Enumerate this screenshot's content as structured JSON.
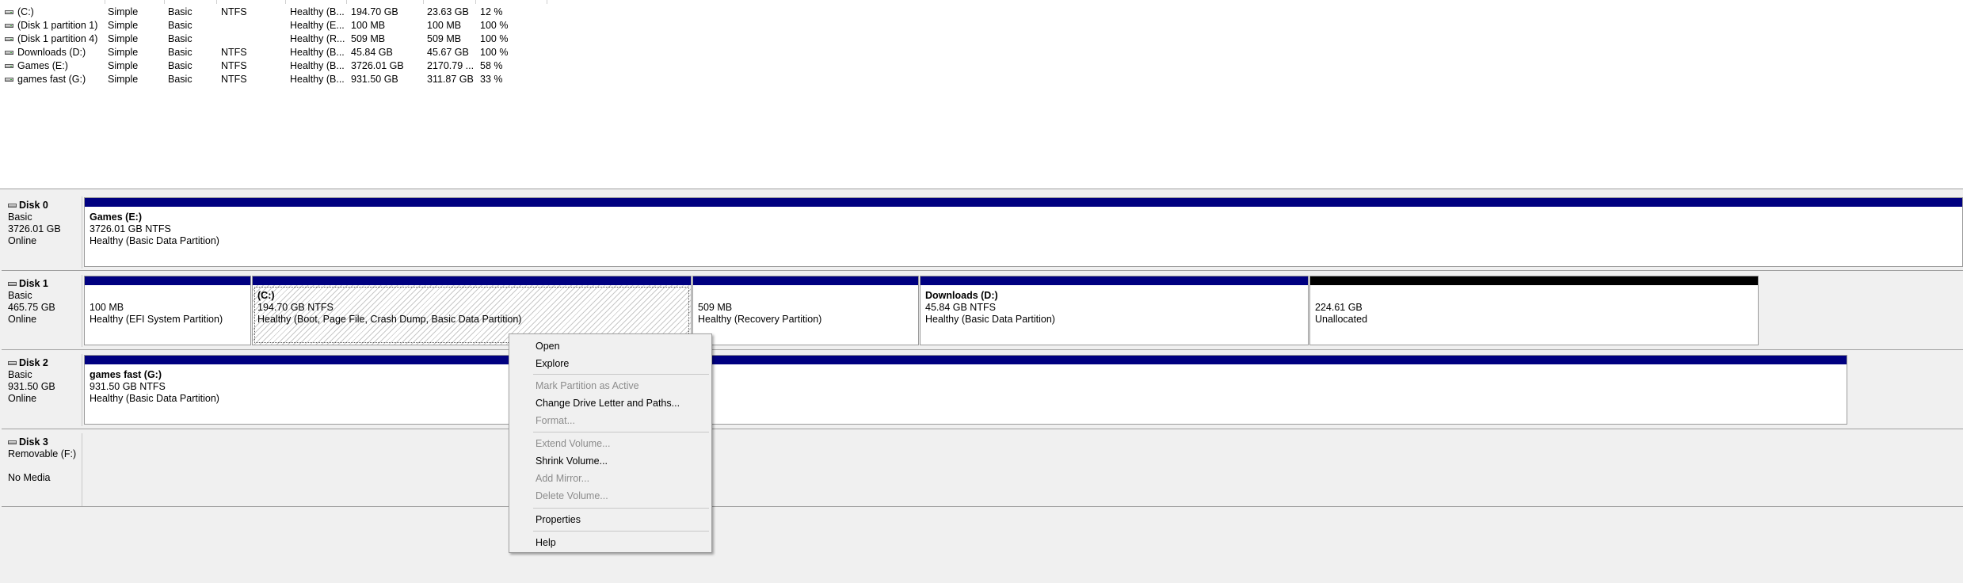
{
  "volumes": [
    {
      "name": "(C:)",
      "layout": "Simple",
      "type": "Basic",
      "fs": "NTFS",
      "status": "Healthy (B...",
      "capacity": "194.70 GB",
      "free": "23.63 GB",
      "pct": "12 %"
    },
    {
      "name": "(Disk 1 partition 1)",
      "layout": "Simple",
      "type": "Basic",
      "fs": "",
      "status": "Healthy (E...",
      "capacity": "100 MB",
      "free": "100 MB",
      "pct": "100 %"
    },
    {
      "name": "(Disk 1 partition 4)",
      "layout": "Simple",
      "type": "Basic",
      "fs": "",
      "status": "Healthy (R...",
      "capacity": "509 MB",
      "free": "509 MB",
      "pct": "100 %"
    },
    {
      "name": "Downloads (D:)",
      "layout": "Simple",
      "type": "Basic",
      "fs": "NTFS",
      "status": "Healthy (B...",
      "capacity": "45.84 GB",
      "free": "45.67 GB",
      "pct": "100 %"
    },
    {
      "name": "Games (E:)",
      "layout": "Simple",
      "type": "Basic",
      "fs": "NTFS",
      "status": "Healthy (B...",
      "capacity": "3726.01 GB",
      "free": "2170.79 ...",
      "pct": "58 %"
    },
    {
      "name": "games fast (G:)",
      "layout": "Simple",
      "type": "Basic",
      "fs": "NTFS",
      "status": "Healthy (B...",
      "capacity": "931.50 GB",
      "free": "311.87 GB",
      "pct": "33 %"
    }
  ],
  "disks": {
    "disk0": {
      "name": "Disk 0",
      "type": "Basic",
      "size": "3726.01 GB",
      "state": "Online"
    },
    "disk1": {
      "name": "Disk 1",
      "type": "Basic",
      "size": "465.75 GB",
      "state": "Online"
    },
    "disk2": {
      "name": "Disk 2",
      "type": "Basic",
      "size": "931.50 GB",
      "state": "Online"
    },
    "disk3": {
      "name": "Disk 3",
      "type": "Removable (F:)",
      "size": "",
      "state": "No Media"
    }
  },
  "partitions": {
    "games_e": {
      "name": "Games  (E:)",
      "size": "3726.01 GB NTFS",
      "status": "Healthy (Basic Data Partition)"
    },
    "efi": {
      "size": "100 MB",
      "status": "Healthy (EFI System Partition)"
    },
    "c": {
      "name": "(C:)",
      "size": "194.70 GB NTFS",
      "status": "Healthy (Boot, Page File, Crash Dump, Basic Data Partition)"
    },
    "recovery": {
      "size": "509 MB",
      "status": "Healthy (Recovery Partition)"
    },
    "downloads_d": {
      "name": "Downloads  (D:)",
      "size": "45.84 GB NTFS",
      "status": "Healthy (Basic Data Partition)"
    },
    "unallocated": {
      "size": "224.61 GB",
      "status": "Unallocated"
    },
    "games_fast_g": {
      "name": "games fast  (G:)",
      "size": "931.50 GB NTFS",
      "status": "Healthy (Basic Data Partition)"
    }
  },
  "context_menu": {
    "open": "Open",
    "explore": "Explore",
    "mark_active": "Mark Partition as Active",
    "change_letter": "Change Drive Letter and Paths...",
    "format": "Format...",
    "extend": "Extend Volume...",
    "shrink": "Shrink Volume...",
    "add_mirror": "Add Mirror...",
    "delete": "Delete Volume...",
    "properties": "Properties",
    "help": "Help"
  },
  "colors": {
    "primary_partition_bar": "#000080",
    "unallocated_bar": "#000000"
  }
}
